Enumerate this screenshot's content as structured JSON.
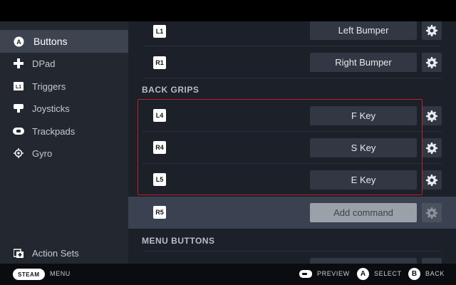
{
  "sidebar": {
    "items": [
      {
        "label": "Buttons",
        "icon": "a-button-icon"
      },
      {
        "label": "DPad",
        "icon": "dpad-icon"
      },
      {
        "label": "Triggers",
        "icon": "l1-trigger-icon"
      },
      {
        "label": "Joysticks",
        "icon": "joystick-icon"
      },
      {
        "label": "Trackpads",
        "icon": "trackpad-icon"
      },
      {
        "label": "Gyro",
        "icon": "gyro-icon"
      }
    ],
    "action_sets": "Action Sets",
    "active_item": "Buttons",
    "icon_a_letter": "A",
    "icon_l1_text": "L1"
  },
  "main": {
    "rows_top": [
      {
        "badge": "L1",
        "command": "Left Bumper"
      },
      {
        "badge": "R1",
        "command": "Right Bumper"
      }
    ],
    "back_grips_header": "BACK GRIPS",
    "back_grips": [
      {
        "badge": "L4",
        "command": "F Key"
      },
      {
        "badge": "R4",
        "command": "S Key"
      },
      {
        "badge": "L5",
        "command": "E Key"
      }
    ],
    "r5_row": {
      "badge": "R5",
      "command": "Add command"
    },
    "menu_buttons_header": "MENU BUTTONS"
  },
  "footer": {
    "steam": "STEAM",
    "menu": "MENU",
    "preview": "PREVIEW",
    "select_key": "A",
    "select": "SELECT",
    "back_key": "B",
    "back": "BACK"
  },
  "colors": {
    "highlight_border": "#c0202b",
    "sidebar_bg": "#232830",
    "main_bg": "#1b2029",
    "command_bg": "#313844"
  }
}
